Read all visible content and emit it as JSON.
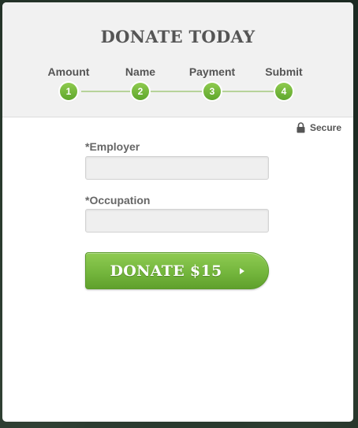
{
  "header": {
    "title": "DONATE TODAY"
  },
  "steps": [
    {
      "label": "Amount",
      "number": "1"
    },
    {
      "label": "Name",
      "number": "2"
    },
    {
      "label": "Payment",
      "number": "3"
    },
    {
      "label": "Submit",
      "number": "4"
    }
  ],
  "secure": {
    "label": "Secure",
    "icon": "lock-icon"
  },
  "form": {
    "employer": {
      "label": "*Employer",
      "value": "",
      "placeholder": ""
    },
    "occupation": {
      "label": "*Occupation",
      "value": "",
      "placeholder": ""
    }
  },
  "donate_button": {
    "label": "DONATE $15",
    "icon": "arrow-right-icon"
  },
  "colors": {
    "accent_green": "#74b63d",
    "header_bg": "#f1f1f1",
    "text_gray": "#555555"
  }
}
